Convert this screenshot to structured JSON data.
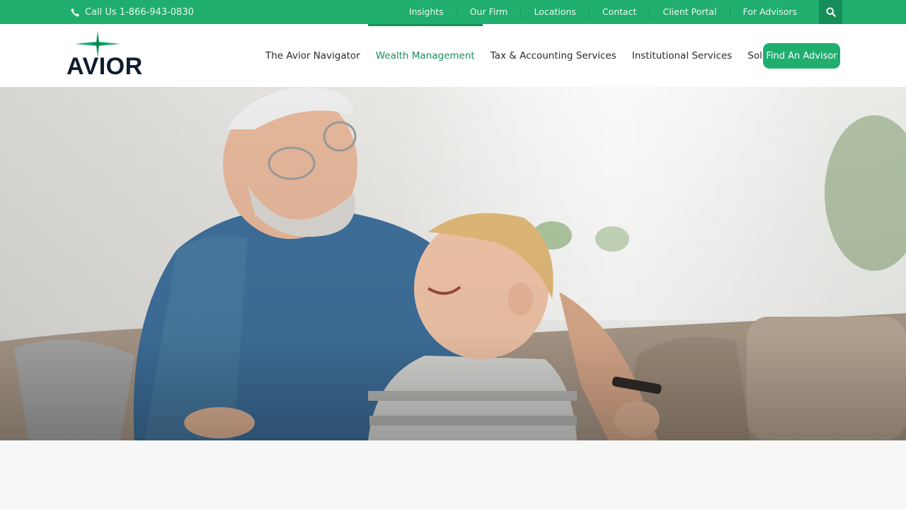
{
  "topbar": {
    "phone_label": "Call Us 1-866-943-0830",
    "links": [
      "Insights",
      "Our Firm",
      "Locations",
      "Contact",
      "Client Portal",
      "For Advisors"
    ]
  },
  "brand": {
    "name": "AVIOR"
  },
  "nav": {
    "items": [
      {
        "label": "The Avior Navigator",
        "active": false
      },
      {
        "label": "Wealth Management",
        "active": true
      },
      {
        "label": "Tax & Accounting Services",
        "active": false
      },
      {
        "label": "Institutional Services",
        "active": false
      },
      {
        "label": "Solutions For",
        "active": false
      }
    ],
    "cta_label": "Find An Advisor"
  },
  "colors": {
    "brand_green": "#1fae6e",
    "active_green": "#1a8f5a",
    "navy": "#0e1c2e"
  },
  "icons": {
    "phone": "phone-icon",
    "search": "search-icon",
    "logo": "star-logo-icon"
  }
}
